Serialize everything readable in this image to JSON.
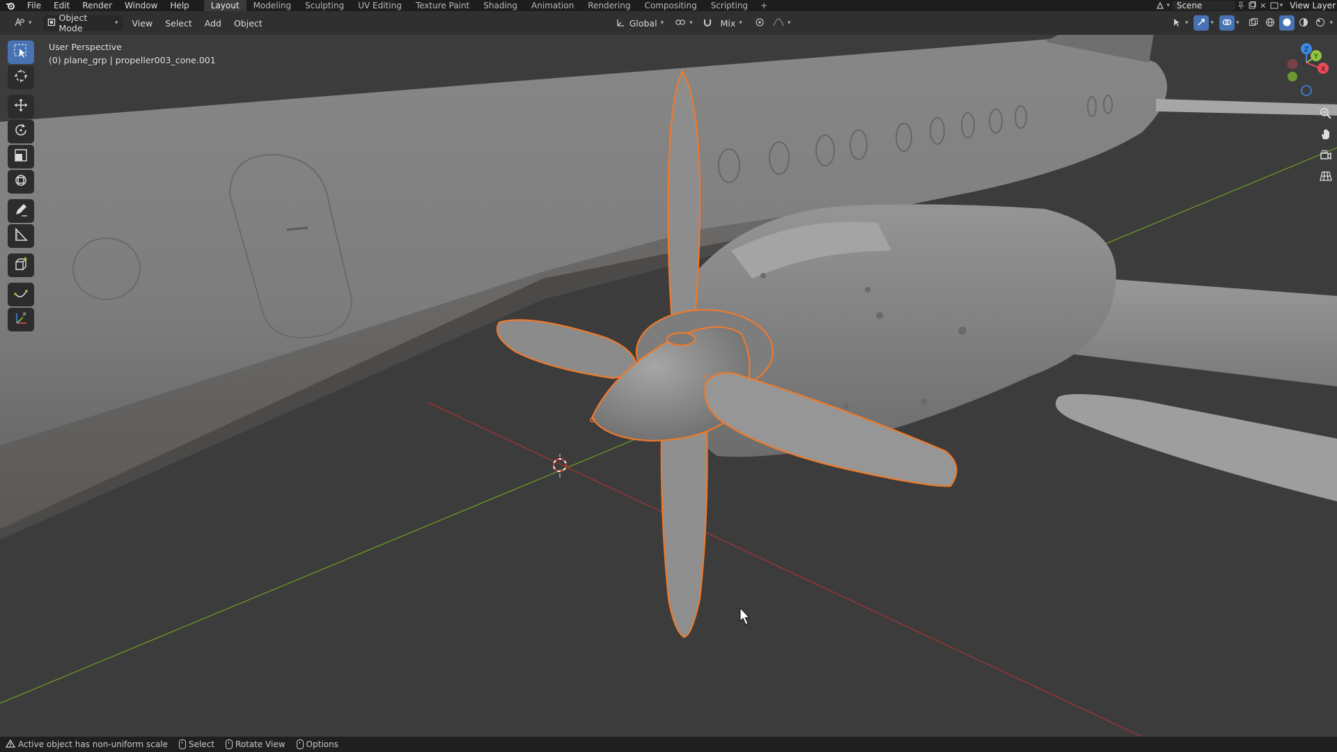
{
  "menubar": {
    "items": [
      "File",
      "Edit",
      "Render",
      "Window",
      "Help"
    ],
    "workspaces": [
      "Layout",
      "Modeling",
      "Sculpting",
      "UV Editing",
      "Texture Paint",
      "Shading",
      "Animation",
      "Rendering",
      "Compositing",
      "Scripting"
    ],
    "active_workspace": "Layout",
    "add_tab": "+",
    "scene_label": "Scene",
    "view_layer_label": "View Layer"
  },
  "viewport_header": {
    "mode": "Object Mode",
    "menus": [
      "View",
      "Select",
      "Add",
      "Object"
    ],
    "orientation": "Global",
    "snap_mode": "Mix"
  },
  "overlay": {
    "perspective": "User Perspective",
    "selection": "(0) plane_grp | propeller003_cone.001"
  },
  "toolbar": {
    "tools": [
      "select-box",
      "cursor",
      "move",
      "rotate",
      "scale",
      "transform",
      "annotate",
      "measure",
      "add-cube",
      "extrude-curve",
      "grease-pencil-point"
    ],
    "active_tool": "select-box"
  },
  "gizmo": {
    "axes": [
      "Z",
      "Y",
      "X"
    ],
    "colors": {
      "x": "#e84b5c",
      "y": "#8fc541",
      "z": "#3f8ae6"
    }
  },
  "status_bar": {
    "warning": "Active object has non-uniform scale",
    "select": "Select",
    "rotate": "Rotate View",
    "options": "Options"
  },
  "colors": {
    "selection_outline": "#ee7a2c",
    "x_axis_line": "#b43131",
    "y_axis_line": "#6c9a24",
    "active_tool": "#4772b3",
    "viewport_bg": "#3d3d3d"
  }
}
